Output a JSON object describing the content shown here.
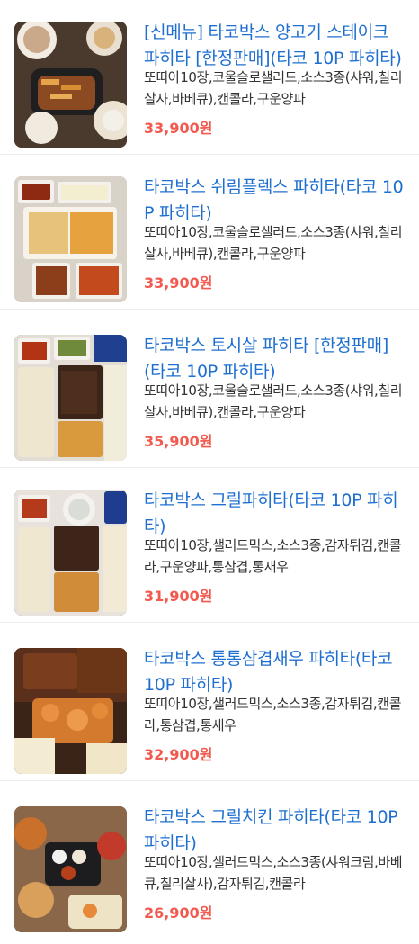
{
  "products": [
    {
      "title": "[신메뉴] 타코박스 양고기 스테이크 파히타 [한정판매](타코 10P 파히타)",
      "desc": "또띠아10장,코울슬로샐러드,소스3종(샤워,칠리살사,바베큐),캔콜라,구운양파",
      "price": "33,900원"
    },
    {
      "title": "타코박스 쉬림플렉스 파히타(타코 10P 파히타)",
      "desc": "또띠아10장,코울슬로샐러드,소스3종(샤워,칠리살사,바베큐),캔콜라,구운양파",
      "price": "33,900원"
    },
    {
      "title": "타코박스 토시살 파히타 [한정판매](타코 10P 파히타)",
      "desc": "또띠아10장,코울슬로샐러드,소스3종(샤워,칠리살사,바베큐),캔콜라,구운양파",
      "price": "35,900원"
    },
    {
      "title": "타코박스 그릴파히타(타코 10P 파히타)",
      "desc": "또띠아10장,샐러드믹스,소스3종,감자튀김,캔콜라,구운양파,통삼겹,통새우",
      "price": "31,900원"
    },
    {
      "title": "타코박스 통통삼겹새우 파히타(타코 10P 파히타)",
      "desc": "또띠아10장,샐러드믹스,소스3종,감자튀김,캔콜라,통삼겹,통새우",
      "price": "32,900원"
    },
    {
      "title": "타코박스 그릴치킨 파히타(타코 10P 파히타)",
      "desc": "또띠아10장,샐러드믹스,소스3종(샤워크림,바베큐,칠리살사),감자튀김,캔콜라",
      "price": "26,900원"
    }
  ]
}
